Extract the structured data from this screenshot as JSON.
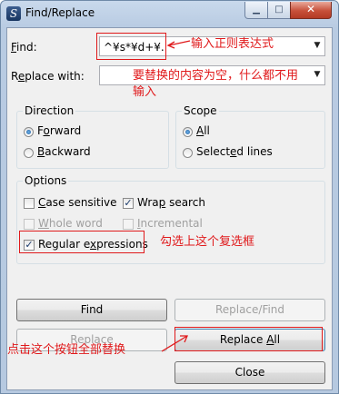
{
  "window": {
    "title": "Find/Replace",
    "app_icon": "find-replace-app-icon",
    "controls": {
      "minimize": "▁",
      "maximize": "□",
      "close": "✕"
    }
  },
  "find": {
    "label_key": "F",
    "label_rest": "ind:",
    "value": "^¥s*¥d+¥."
  },
  "replace": {
    "label_pre": "R",
    "label_key": "e",
    "label_rest": "place with:",
    "value": ""
  },
  "direction": {
    "title": "Direction",
    "options": [
      {
        "pre": "F",
        "key": "o",
        "rest": "rward",
        "checked": true
      },
      {
        "pre": "",
        "key": "B",
        "rest": "ackward",
        "checked": false
      }
    ]
  },
  "scope": {
    "title": "Scope",
    "options": [
      {
        "pre": "",
        "key": "A",
        "rest": "ll",
        "checked": true
      },
      {
        "pre": "Select",
        "key": "e",
        "rest": "d lines",
        "checked": false
      }
    ]
  },
  "options": {
    "title": "Options",
    "case_sensitive": {
      "key": "C",
      "rest": "ase sensitive",
      "checked": false,
      "enabled": true
    },
    "wrap_search": {
      "pre": "Wra",
      "key": "p",
      "rest": " search",
      "checked": true,
      "enabled": true
    },
    "whole_word": {
      "key": "W",
      "rest": "hole word",
      "checked": false,
      "enabled": false
    },
    "incremental": {
      "key": "I",
      "rest": "ncremental",
      "checked": false,
      "enabled": false
    },
    "regular_expressions": {
      "pre": "Regular e",
      "key": "x",
      "rest": "pressions",
      "checked": true,
      "enabled": true
    }
  },
  "buttons": {
    "find": {
      "label": "Find",
      "enabled": true
    },
    "replace_find": {
      "label": "Replace/Find",
      "enabled": false
    },
    "replace": {
      "label": "Replace",
      "enabled": false
    },
    "replace_all": {
      "pre": "Replace ",
      "key": "A",
      "rest": "ll",
      "enabled": true
    },
    "close": {
      "label": "Close",
      "enabled": true
    }
  },
  "annotations": {
    "find_hint": "输入正则表达式",
    "replace_hint_line1": "要替换的内容为空，什么都不用",
    "replace_hint_line2": "输入",
    "regex_hint": "勾选上这个复选框",
    "replace_all_hint": "点击这个按钮全部替换",
    "color": "#e0191b"
  }
}
